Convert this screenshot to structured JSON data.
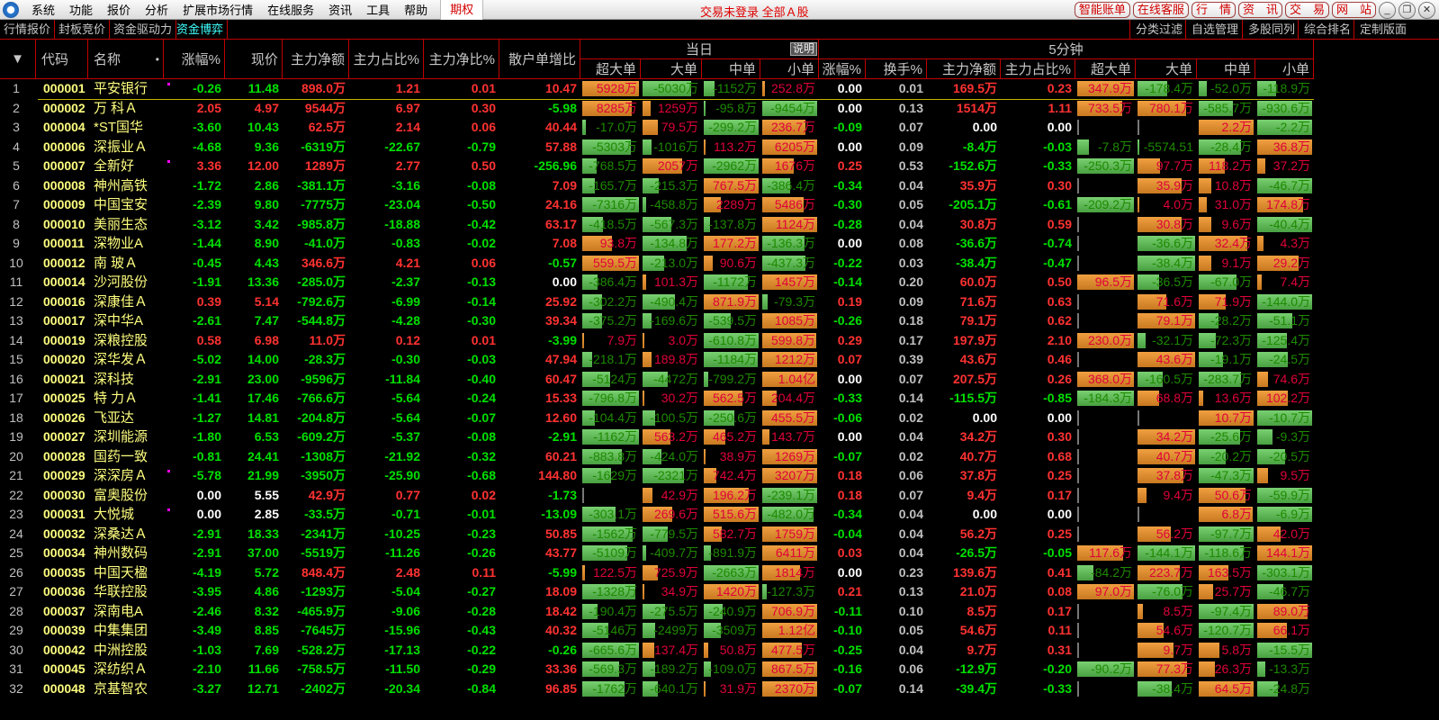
{
  "menubar": {
    "items": [
      "系统",
      "功能",
      "报价",
      "分析",
      "扩展市场行情",
      "在线服务",
      "资讯",
      "工具",
      "帮助"
    ],
    "option": "期权",
    "status": "交易未登录  全部Ａ股",
    "buttons": [
      "智能账单",
      "在线客服",
      "行　情",
      "资　讯",
      "交　易",
      "网　站"
    ],
    "window": [
      "minimize-icon",
      "restore-icon",
      "close-icon"
    ]
  },
  "tabs": {
    "left": [
      "行情报价",
      "封板竞价",
      "资金驱动力",
      "资金博弈"
    ],
    "active": 3,
    "right": [
      "分类过滤",
      "自选管理",
      "多股同列",
      "综合排名",
      "定制版面"
    ]
  },
  "header": {
    "sort": "▼",
    "code": "代码",
    "name": "名称",
    "name_dot": "•",
    "chg": "涨幅%",
    "price": "现价",
    "net": "主力净额",
    "ratio": "主力占比%",
    "netratio": "主力净比%",
    "retail": "散户单增比",
    "day": "当日",
    "explain": "说明",
    "min5": "5分钟",
    "day_cols": [
      "超大单",
      "大单",
      "中单",
      "小单"
    ],
    "min_cols": [
      "涨幅%",
      "换手%",
      "主力净额",
      "主力占比%",
      "超大单",
      "大单",
      "中单",
      "小单"
    ]
  },
  "colors": {
    "up": "#ff3232",
    "down": "#00e000",
    "flat": "#ffffff",
    "bar_up": "#e8963a",
    "bar_down": "#62c05a",
    "grid": "#c00000"
  },
  "rows": [
    [
      "1",
      "000001",
      "平安银行",
      true,
      "-0.26",
      "11.48",
      "898.0万",
      "1.21",
      "0.01",
      "10.47",
      [
        "5928万",
        "-5030万",
        "-1152万",
        "252.8万"
      ],
      [
        "0.00",
        "0.01",
        "169.5万",
        "0.23"
      ],
      [
        "347.9万",
        "-178.4万",
        "-52.0万",
        "-118.9万"
      ]
    ],
    [
      "2",
      "000002",
      "万 科Ａ",
      false,
      "2.05",
      "4.97",
      "9544万",
      "6.97",
      "0.30",
      "-5.98",
      [
        "8285万",
        "1259万",
        "-95.8万",
        "-9454万"
      ],
      [
        "0.00",
        "0.13",
        "1514万",
        "1.11"
      ],
      [
        "733.5万",
        "780.1万",
        "-585.7万",
        "-930.6万"
      ]
    ],
    [
      "3",
      "000004",
      "*ST国华",
      false,
      "-3.60",
      "10.43",
      "62.5万",
      "2.14",
      "0.06",
      "40.44",
      [
        "-17.0万",
        "79.5万",
        "-299.2万",
        "236.7万"
      ],
      [
        "-0.09",
        "0.07",
        "0.00",
        "0.00"
      ],
      [
        "",
        "",
        "2.2万",
        "-2.2万"
      ]
    ],
    [
      "4",
      "000006",
      "深振业Ａ",
      false,
      "-4.68",
      "9.36",
      "-6319万",
      "-22.67",
      "-0.79",
      "57.88",
      [
        "-5303万",
        "-1016万",
        "113.2万",
        "6205万"
      ],
      [
        "0.00",
        "0.09",
        "-8.4万",
        "-0.03"
      ],
      [
        "-7.8万",
        "-5574.51",
        "-28.4万",
        "36.8万"
      ]
    ],
    [
      "5",
      "000007",
      "全新好",
      true,
      "3.36",
      "12.00",
      "1289万",
      "2.77",
      "0.50",
      "-256.96",
      [
        "-768.5万",
        "2057万",
        "-2962万",
        "1676万"
      ],
      [
        "0.25",
        "0.53",
        "-152.6万",
        "-0.33"
      ],
      [
        "-250.3万",
        "97.7万",
        "118.2万",
        "37.2万"
      ]
    ],
    [
      "6",
      "000008",
      "神州高铁",
      false,
      "-1.72",
      "2.86",
      "-381.1万",
      "-3.16",
      "-0.08",
      "7.09",
      [
        "-165.7万",
        "-215.3万",
        "767.5万",
        "-386.4万"
      ],
      [
        "-0.34",
        "0.04",
        "35.9万",
        "0.30"
      ],
      [
        "",
        "35.9万",
        "10.8万",
        "-46.7万"
      ]
    ],
    [
      "7",
      "000009",
      "中国宝安",
      false,
      "-2.39",
      "9.80",
      "-7775万",
      "-23.04",
      "-0.50",
      "24.16",
      [
        "-7316万",
        "-458.8万",
        "2289万",
        "5486万"
      ],
      [
        "-0.30",
        "0.05",
        "-205.1万",
        "-0.61"
      ],
      [
        "-209.2万",
        "4.0万",
        "31.0万",
        "174.8万"
      ]
    ],
    [
      "8",
      "000010",
      "美丽生态",
      false,
      "-3.12",
      "3.42",
      "-985.8万",
      "-18.88",
      "-0.42",
      "63.17",
      [
        "-418.5万",
        "-567.3万",
        "-137.8万",
        "1124万"
      ],
      [
        "-0.28",
        "0.04",
        "30.8万",
        "0.59"
      ],
      [
        "",
        "30.8万",
        "9.6万",
        "-40.4万"
      ]
    ],
    [
      "9",
      "000011",
      "深物业A",
      false,
      "-1.44",
      "8.90",
      "-41.0万",
      "-0.83",
      "-0.02",
      "7.08",
      [
        "93.8万",
        "-134.8万",
        "177.2万",
        "-136.3万"
      ],
      [
        "0.00",
        "0.08",
        "-36.6万",
        "-0.74"
      ],
      [
        "",
        "-36.6万",
        "32.4万",
        "4.3万"
      ]
    ],
    [
      "10",
      "000012",
      "南 玻Ａ",
      false,
      "-0.45",
      "4.43",
      "346.6万",
      "4.21",
      "0.06",
      "-0.57",
      [
        "559.5万",
        "-213.0万",
        "90.6万",
        "-437.3万"
      ],
      [
        "-0.22",
        "0.03",
        "-38.4万",
        "-0.47"
      ],
      [
        "",
        "-38.4万",
        "9.1万",
        "29.2万"
      ]
    ],
    [
      "11",
      "000014",
      "沙河股份",
      false,
      "-1.91",
      "13.36",
      "-285.0万",
      "-2.37",
      "-0.13",
      "0.00",
      [
        "-386.4万",
        "101.3万",
        "-1172万",
        "1457万"
      ],
      [
        "-0.14",
        "0.20",
        "60.0万",
        "0.50"
      ],
      [
        "96.5万",
        "-36.5万",
        "-67.0万",
        "7.4万"
      ]
    ],
    [
      "12",
      "000016",
      "深康佳Ａ",
      false,
      "0.39",
      "5.14",
      "-792.6万",
      "-6.99",
      "-0.14",
      "25.92",
      [
        "-302.2万",
        "-490.4万",
        "871.9万",
        "-79.3万"
      ],
      [
        "0.19",
        "0.09",
        "71.6万",
        "0.63"
      ],
      [
        "",
        "71.6万",
        "71.9万",
        "-144.0万"
      ]
    ],
    [
      "13",
      "000017",
      "深中华A",
      false,
      "-2.61",
      "7.47",
      "-544.8万",
      "-4.28",
      "-0.30",
      "39.34",
      [
        "-375.2万",
        "-169.6万",
        "-539.5万",
        "1085万"
      ],
      [
        "-0.26",
        "0.18",
        "79.1万",
        "0.62"
      ],
      [
        "",
        "79.1万",
        "-28.2万",
        "-51.1万"
      ]
    ],
    [
      "14",
      "000019",
      "深粮控股",
      false,
      "0.58",
      "6.98",
      "11.0万",
      "0.12",
      "0.01",
      "-3.99",
      [
        "7.9万",
        "3.0万",
        "-610.8万",
        "599.8万"
      ],
      [
        "0.29",
        "0.17",
        "197.9万",
        "2.10"
      ],
      [
        "230.0万",
        "-32.1万",
        "-72.3万",
        "-125.4万"
      ]
    ],
    [
      "15",
      "000020",
      "深华发Ａ",
      false,
      "-5.02",
      "14.00",
      "-28.3万",
      "-0.30",
      "-0.03",
      "47.94",
      [
        "-218.1万",
        "189.8万",
        "-1184万",
        "1212万"
      ],
      [
        "0.07",
        "0.39",
        "43.6万",
        "0.46"
      ],
      [
        "",
        "43.6万",
        "-19.1万",
        "-24.5万"
      ]
    ],
    [
      "16",
      "000021",
      "深科技",
      false,
      "-2.91",
      "23.00",
      "-9596万",
      "-11.84",
      "-0.40",
      "60.47",
      [
        "-5124万",
        "-4472万",
        "-799.2万",
        "1.04亿"
      ],
      [
        "0.00",
        "0.07",
        "207.5万",
        "0.26"
      ],
      [
        "368.0万",
        "-160.5万",
        "-283.7万",
        "74.6万"
      ]
    ],
    [
      "17",
      "000025",
      "特 力Ａ",
      false,
      "-1.41",
      "17.46",
      "-766.6万",
      "-5.64",
      "-0.24",
      "15.33",
      [
        "-796.8万",
        "30.2万",
        "562.5万",
        "204.4万"
      ],
      [
        "-0.33",
        "0.14",
        "-115.5万",
        "-0.85"
      ],
      [
        "-184.3万",
        "68.8万",
        "13.6万",
        "102.2万"
      ]
    ],
    [
      "18",
      "000026",
      "飞亚达",
      false,
      "-1.27",
      "14.81",
      "-204.8万",
      "-5.64",
      "-0.07",
      "12.60",
      [
        "-104.4万",
        "-100.5万",
        "-250.6万",
        "455.5万"
      ],
      [
        "-0.06",
        "0.02",
        "0.00",
        "0.00"
      ],
      [
        "",
        "",
        "10.7万",
        "-10.7万"
      ]
    ],
    [
      "19",
      "000027",
      "深圳能源",
      false,
      "-1.80",
      "6.53",
      "-609.2万",
      "-5.37",
      "-0.08",
      "-2.91",
      [
        "-1162万",
        "563.2万",
        "465.2万",
        "143.7万"
      ],
      [
        "0.00",
        "0.04",
        "34.2万",
        "0.30"
      ],
      [
        "",
        "34.2万",
        "-25.6万",
        "-9.3万"
      ]
    ],
    [
      "20",
      "000028",
      "国药一致",
      false,
      "-0.81",
      "24.41",
      "-1308万",
      "-21.92",
      "-0.32",
      "60.21",
      [
        "-883.8万",
        "-424.0万",
        "38.9万",
        "1269万"
      ],
      [
        "-0.07",
        "0.02",
        "40.7万",
        "0.68"
      ],
      [
        "",
        "40.7万",
        "-20.2万",
        "-20.5万"
      ]
    ],
    [
      "21",
      "000029",
      "深深房Ａ",
      true,
      "-5.78",
      "21.99",
      "-3950万",
      "-25.90",
      "-0.68",
      "144.80",
      [
        "-1629万",
        "-2321万",
        "742.4万",
        "3207万"
      ],
      [
        "0.18",
        "0.06",
        "37.8万",
        "0.25"
      ],
      [
        "",
        "37.8万",
        "-47.3万",
        "9.5万"
      ]
    ],
    [
      "22",
      "000030",
      "富奥股份",
      false,
      "0.00",
      "5.55",
      "42.9万",
      "0.77",
      "0.02",
      "-1.73",
      [
        "",
        "42.9万",
        "196.2万",
        "-239.1万"
      ],
      [
        "0.18",
        "0.07",
        "9.4万",
        "0.17"
      ],
      [
        "",
        "9.4万",
        "50.6万",
        "-59.9万"
      ]
    ],
    [
      "23",
      "000031",
      "大悦城",
      true,
      "0.00",
      "2.85",
      "-33.5万",
      "-0.71",
      "-0.01",
      "-13.09",
      [
        "-303.1万",
        "269.6万",
        "515.6万",
        "-482.0万"
      ],
      [
        "-0.34",
        "0.04",
        "0.00",
        "0.00"
      ],
      [
        "",
        "",
        "6.8万",
        "-6.9万"
      ]
    ],
    [
      "24",
      "000032",
      "深桑达Ａ",
      false,
      "-2.91",
      "18.33",
      "-2341万",
      "-10.25",
      "-0.23",
      "50.85",
      [
        "-1562万",
        "-779.5万",
        "582.7万",
        "1759万"
      ],
      [
        "-0.04",
        "0.04",
        "56.2万",
        "0.25"
      ],
      [
        "",
        "56.2万",
        "-97.7万",
        "42.0万"
      ]
    ],
    [
      "25",
      "000034",
      "神州数码",
      false,
      "-2.91",
      "37.00",
      "-5519万",
      "-11.26",
      "-0.26",
      "43.77",
      [
        "-5109万",
        "-409.7万",
        "-891.9万",
        "6411万"
      ],
      [
        "0.03",
        "0.04",
        "-26.5万",
        "-0.05"
      ],
      [
        "117.6万",
        "-144.1万",
        "-118.6万",
        "144.1万"
      ]
    ],
    [
      "26",
      "000035",
      "中国天楹",
      false,
      "-4.19",
      "5.72",
      "848.4万",
      "2.48",
      "0.11",
      "-5.99",
      [
        "122.5万",
        "725.9万",
        "-2663万",
        "1814万"
      ],
      [
        "0.00",
        "0.23",
        "139.6万",
        "0.41"
      ],
      [
        "-84.2万",
        "223.7万",
        "163.5万",
        "-303.1万"
      ]
    ],
    [
      "27",
      "000036",
      "华联控股",
      false,
      "-3.95",
      "4.86",
      "-1293万",
      "-5.04",
      "-0.27",
      "18.09",
      [
        "-1328万",
        "34.9万",
        "1420万",
        "-127.3万"
      ],
      [
        "0.21",
        "0.13",
        "21.0万",
        "0.08"
      ],
      [
        "97.0万",
        "-76.0万",
        "25.7万",
        "-46.7万"
      ]
    ],
    [
      "28",
      "000037",
      "深南电A",
      false,
      "-2.46",
      "8.32",
      "-465.9万",
      "-9.06",
      "-0.28",
      "18.42",
      [
        "-190.4万",
        "-275.5万",
        "-240.9万",
        "706.9万"
      ],
      [
        "-0.11",
        "0.10",
        "8.5万",
        "0.17"
      ],
      [
        "",
        "8.5万",
        "-97.4万",
        "89.0万"
      ]
    ],
    [
      "29",
      "000039",
      "中集集团",
      false,
      "-3.49",
      "8.85",
      "-7645万",
      "-15.96",
      "-0.43",
      "40.32",
      [
        "-5146万",
        "-2499万",
        "-3509万",
        "1.12亿"
      ],
      [
        "-0.10",
        "0.05",
        "54.6万",
        "0.11"
      ],
      [
        "",
        "54.6万",
        "-120.7万",
        "66.1万"
      ]
    ],
    [
      "30",
      "000042",
      "中洲控股",
      false,
      "-1.03",
      "7.69",
      "-528.2万",
      "-17.13",
      "-0.22",
      "-0.26",
      [
        "-665.6万",
        "137.4万",
        "50.8万",
        "477.5万"
      ],
      [
        "-0.25",
        "0.04",
        "9.7万",
        "0.31"
      ],
      [
        "",
        "9.7万",
        "5.8万",
        "-15.5万"
      ]
    ],
    [
      "31",
      "000045",
      "深纺织Ａ",
      false,
      "-2.10",
      "11.66",
      "-758.5万",
      "-11.50",
      "-0.29",
      "33.36",
      [
        "-569.3万",
        "-189.2万",
        "-109.0万",
        "867.5万"
      ],
      [
        "-0.16",
        "0.06",
        "-12.9万",
        "-0.20"
      ],
      [
        "-90.2万",
        "77.3万",
        "26.3万",
        "-13.3万"
      ]
    ],
    [
      "32",
      "000048",
      "京基智农",
      false,
      "-3.27",
      "12.71",
      "-2402万",
      "-20.34",
      "-0.84",
      "96.85",
      [
        "-1762万",
        "-640.1万",
        "31.9万",
        "2370万"
      ],
      [
        "-0.07",
        "0.14",
        "-39.4万",
        "-0.33"
      ],
      [
        "",
        "-38.4万",
        "64.5万",
        "-24.8万"
      ]
    ]
  ]
}
